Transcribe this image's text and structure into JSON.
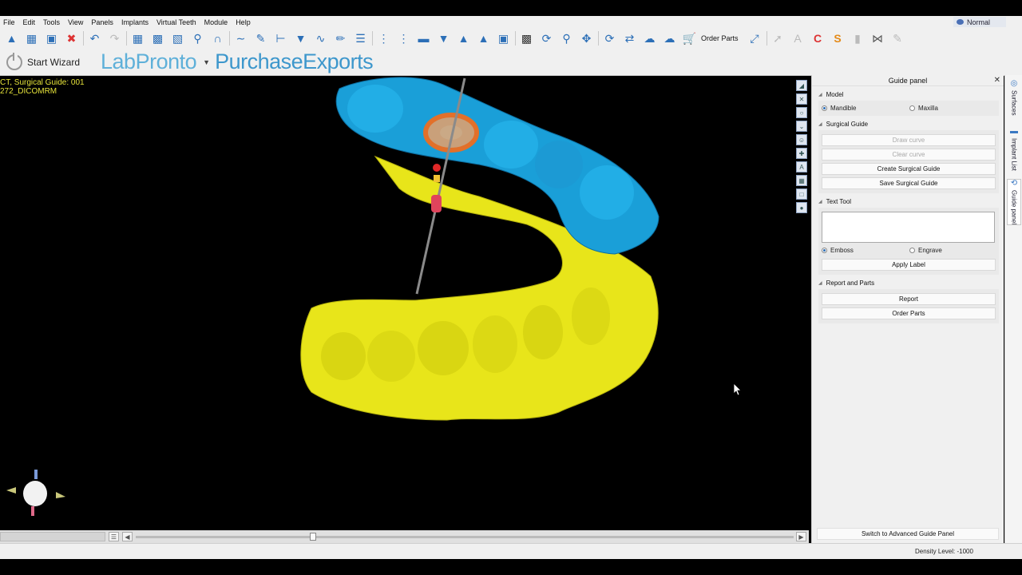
{
  "menubar": {
    "items": [
      "File",
      "Edit",
      "Tools",
      "View",
      "Panels",
      "Implants",
      "Virtual Teeth",
      "Module",
      "Help"
    ],
    "mode": "Normal"
  },
  "toolbar": {
    "order_parts_label": "Order Parts"
  },
  "brandbar": {
    "start_wizard": "Start Wizard",
    "lab_prefix": "Lab",
    "lab_suffix": "Pronto",
    "purchase_prefix": "Purchase",
    "purchase_suffix": "Exports"
  },
  "viewport": {
    "info_line1": "CT, Surgical Guide: 001",
    "info_line2": "272_DICOMRM",
    "slider_position": 0.27
  },
  "guide_panel": {
    "title": "Guide panel",
    "model": {
      "heading": "Model",
      "options": [
        "Mandible",
        "Maxilla"
      ],
      "selected": "Mandible"
    },
    "surgical_guide": {
      "heading": "Surgical Guide",
      "draw_curve": "Draw curve",
      "clear_curve": "Clear curve",
      "create": "Create Surgical Guide",
      "save": "Save Surgical Guide"
    },
    "text_tool": {
      "heading": "Text Tool",
      "text_value": "",
      "options": [
        "Emboss",
        "Engrave"
      ],
      "selected": "Emboss",
      "apply": "Apply Label"
    },
    "report_parts": {
      "heading": "Report and Parts",
      "report": "Report",
      "order_parts": "Order Parts"
    },
    "switch_advanced": "Switch to Advanced Guide Panel"
  },
  "vertical_tabs": [
    "Surfaces",
    "Implant List",
    "Guide panel"
  ],
  "statusbar": {
    "density": "Density Level: -1000"
  },
  "colors": {
    "accent": "#3d97cc",
    "maxilla": "#1a9fd8",
    "mandible": "#e8e51a",
    "info_text": "#e6e33a"
  }
}
